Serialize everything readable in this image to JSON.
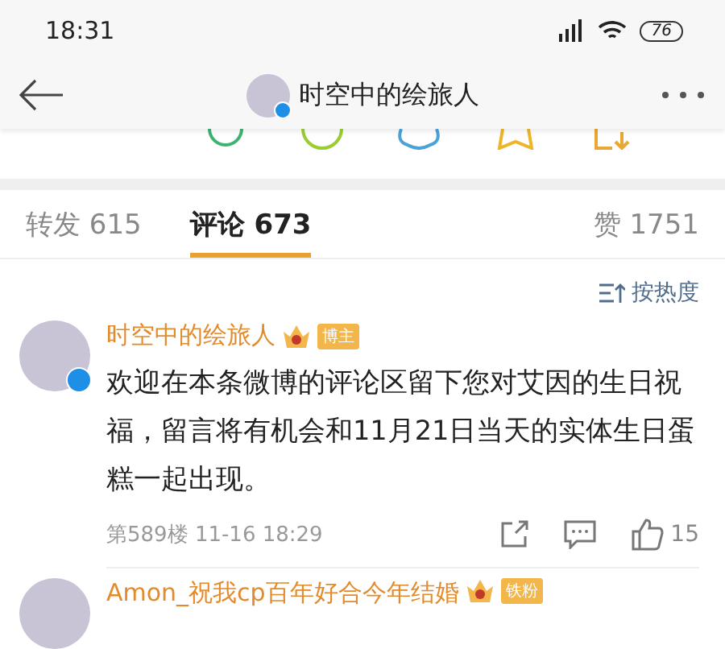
{
  "status_bar": {
    "time": "18:31",
    "battery": "76"
  },
  "nav": {
    "title": "时空中的绘旅人"
  },
  "tabs": [
    {
      "label": "转发 615",
      "selected": false
    },
    {
      "label": "评论 673",
      "selected": true
    }
  ],
  "likes_tab": {
    "label": "赞 1751",
    "selected": false
  },
  "sort": {
    "label": "按热度"
  },
  "comments": [
    {
      "name": "时空中的绘旅人",
      "badge": "博主",
      "verified": true,
      "text": "欢迎在本条微博的评论区留下您对艾因的生日祝福，留言将有机会和11月21日当天的实体生日蛋糕一起出现。",
      "meta": "第589楼 11-16 18:29",
      "likes": "15"
    },
    {
      "name": "Amon_祝我cp百年好合今年结婚",
      "badge": "铁粉",
      "verified": false
    }
  ]
}
